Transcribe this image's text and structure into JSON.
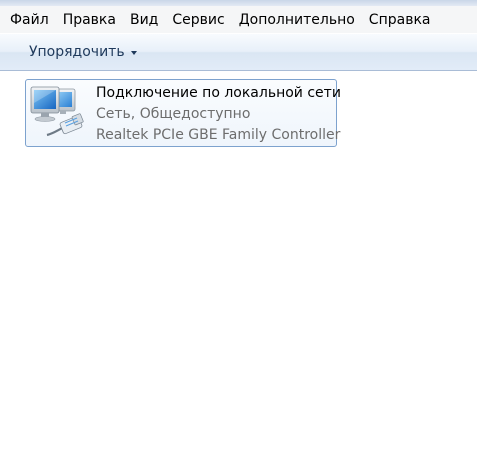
{
  "menubar": {
    "items": [
      "Файл",
      "Правка",
      "Вид",
      "Сервис",
      "Дополнительно",
      "Справка"
    ]
  },
  "toolbar": {
    "organize_label": "Упорядочить"
  },
  "connection": {
    "name": "Подключение по локальной сети",
    "status": "Сеть, Общедоступно",
    "device": "Realtek PCIe GBE Family Controller",
    "icon": "network-connection-icon"
  },
  "colors": {
    "toolbar_text": "#1e395b",
    "tile_border": "#7da2ce",
    "secondary_text": "#6d6d6d"
  }
}
